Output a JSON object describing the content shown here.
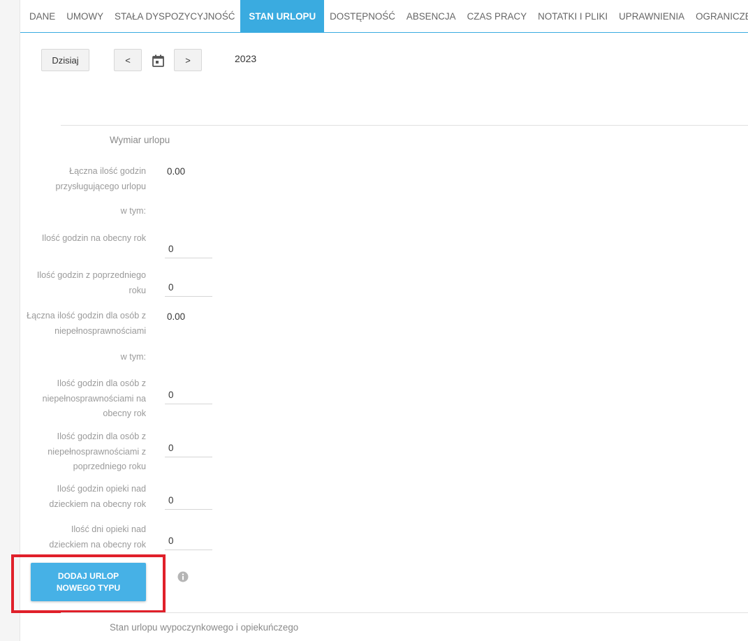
{
  "tabs": [
    {
      "label": "DANE"
    },
    {
      "label": "UMOWY"
    },
    {
      "label": "STAŁA DYSPOZYCYJNOŚĆ"
    },
    {
      "label": "STAN URLOPU"
    },
    {
      "label": "DOSTĘPNOŚĆ"
    },
    {
      "label": "ABSENCJA"
    },
    {
      "label": "CZAS PRACY"
    },
    {
      "label": "NOTATKI I PLIKI"
    },
    {
      "label": "UPRAWNIENIA"
    },
    {
      "label": "OGRANICZENIA"
    }
  ],
  "active_tab": "STAN URLOPU",
  "toolbar": {
    "today_label": "Dzisiaj",
    "prev_label": "<",
    "next_label": ">",
    "year": "2023",
    "calendar_icon": "calendar-icon"
  },
  "sections": {
    "wymiar_title": "Wymiar urlopu",
    "stan_title": "Stan urlopu wypoczynkowego i opiekuńczego"
  },
  "fields": {
    "total_hours_label": "Łączna ilość godzin przysługującego urlopu",
    "total_hours_value": "0.00",
    "w_tym_1": "w tym:",
    "current_year_label": "Ilość godzin na obecny rok",
    "current_year_value": "0",
    "previous_year_label": "Ilość godzin z poprzedniego roku",
    "previous_year_value": "0",
    "disabled_total_label": "Łączna ilość godzin dla osób z niepełnosprawnościami",
    "disabled_total_value": "0.00",
    "w_tym_2": "w tym:",
    "disabled_current_label": "Ilość godzin dla osób z niepełnosprawnościami na obecny rok",
    "disabled_current_value": "0",
    "disabled_previous_label": "Ilość godzin dla osób z niepełnosprawnościami z poprzedniego roku",
    "disabled_previous_value": "0",
    "childcare_hours_label": "Ilość godzin opieki nad dzieckiem na obecny rok",
    "childcare_hours_value": "0",
    "childcare_days_label": "Ilość dni opieki nad dzieckiem na obecny rok",
    "childcare_days_value": "0"
  },
  "add_button": {
    "label": "DODAJ URLOP NOWEGO TYPU",
    "info_icon": "info-icon"
  },
  "colors": {
    "accent": "#3aabe0",
    "highlight": "#e0202a"
  }
}
